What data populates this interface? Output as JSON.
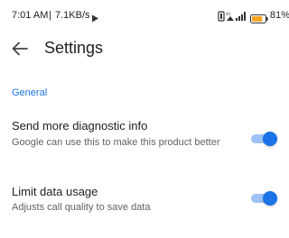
{
  "status_bar": {
    "time": "7:01 AM",
    "separator": "|",
    "net_speed": "7.1KB/s",
    "battery_percent": "81%",
    "battery_level": 0.81,
    "icons": [
      "play-icon",
      "vibrate-icon",
      "wifi-icon",
      "signal-icon",
      "battery-icon"
    ]
  },
  "header": {
    "title": "Settings",
    "back_icon": "arrow-left-icon"
  },
  "sections": [
    {
      "title": "General",
      "items": [
        {
          "title": "Send more diagnostic info",
          "subtitle": "Google can use this to make this product better",
          "enabled": true
        },
        {
          "title": "Limit data usage",
          "subtitle": "Adjusts call quality to save data",
          "enabled": true
        }
      ]
    }
  ],
  "colors": {
    "accent": "#1a73e8",
    "track_on": "#9ec2f5",
    "text_primary": "#202124",
    "text_secondary": "#5f6368"
  }
}
